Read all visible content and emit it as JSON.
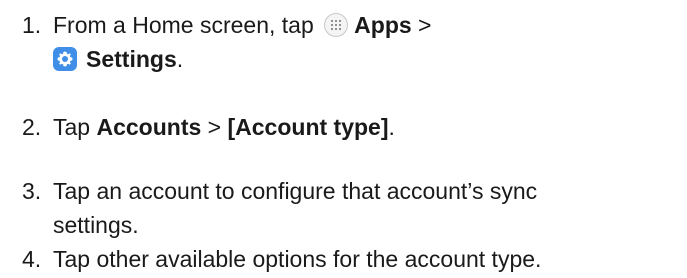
{
  "steps": [
    {
      "number": "1.",
      "line1_text": "From a Home screen, tap",
      "apps_label": "Apps",
      "separator": ">",
      "settings_label": "Settings",
      "period": ".",
      "icons": [
        "apps-icon",
        "settings-icon"
      ]
    },
    {
      "number": "2.",
      "text": "Tap",
      "accounts_label": "Accounts",
      "separator": ">",
      "account_type_label": "[Account type]",
      "period": "."
    },
    {
      "number": "3.",
      "line1": "Tap an account to configure that account’s sync",
      "line2": "settings."
    },
    {
      "number": "4.",
      "text": "Tap other available options for the account type."
    }
  ],
  "colors": {
    "text": "#1a1a1a",
    "settings_icon_bg": "#3f8ee8"
  }
}
